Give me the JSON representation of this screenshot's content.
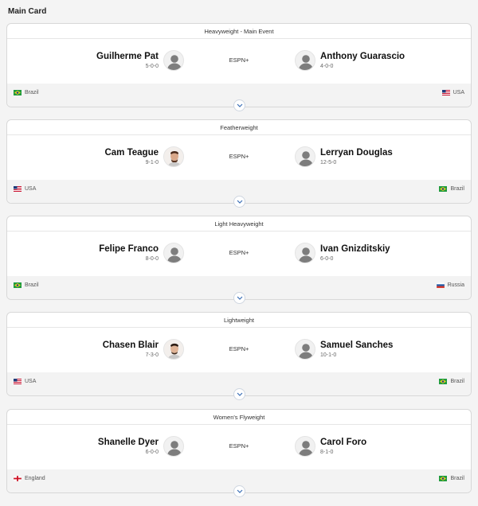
{
  "section_title": "Main Card",
  "fights": [
    {
      "weight_class": "Heavyweight - Main Event",
      "broadcast": "ESPN+",
      "left": {
        "name": "Guilherme Pat",
        "record": "5-0-0",
        "country": "Brazil",
        "flag": "brazil-flag",
        "photo": "placeholder"
      },
      "right": {
        "name": "Anthony Guarascio",
        "record": "4-0-0",
        "country": "USA",
        "flag": "usa-flag",
        "photo": "placeholder"
      }
    },
    {
      "weight_class": "Featherweight",
      "broadcast": "ESPN+",
      "left": {
        "name": "Cam Teague",
        "record": "9-1-0",
        "country": "USA",
        "flag": "usa-flag",
        "photo": "headshot"
      },
      "right": {
        "name": "Lerryan Douglas",
        "record": "12-5-0",
        "country": "Brazil",
        "flag": "brazil-flag",
        "photo": "placeholder"
      }
    },
    {
      "weight_class": "Light Heavyweight",
      "broadcast": "ESPN+",
      "left": {
        "name": "Felipe Franco",
        "record": "8-0-0",
        "country": "Brazil",
        "flag": "brazil-flag",
        "photo": "placeholder"
      },
      "right": {
        "name": "Ivan Gnizditskiy",
        "record": "6-0-0",
        "country": "Russia",
        "flag": "russia-flag",
        "photo": "placeholder"
      }
    },
    {
      "weight_class": "Lightweight",
      "broadcast": "ESPN+",
      "left": {
        "name": "Chasen Blair",
        "record": "7-3-0",
        "country": "USA",
        "flag": "usa-flag",
        "photo": "headshot"
      },
      "right": {
        "name": "Samuel Sanches",
        "record": "10-1-0",
        "country": "Brazil",
        "flag": "brazil-flag",
        "photo": "placeholder"
      }
    },
    {
      "weight_class": "Women's Flyweight",
      "broadcast": "ESPN+",
      "left": {
        "name": "Shanelle Dyer",
        "record": "6-0-0",
        "country": "England",
        "flag": "england-flag",
        "photo": "placeholder"
      },
      "right": {
        "name": "Carol Foro",
        "record": "8-1-0",
        "country": "Brazil",
        "flag": "brazil-flag",
        "photo": "placeholder"
      }
    }
  ],
  "colors": {
    "page_bg": "#f4f4f4",
    "card_bg": "#ffffff",
    "footer_bg": "#f3f3f3",
    "expand_chevron": "#3b6fb6"
  }
}
